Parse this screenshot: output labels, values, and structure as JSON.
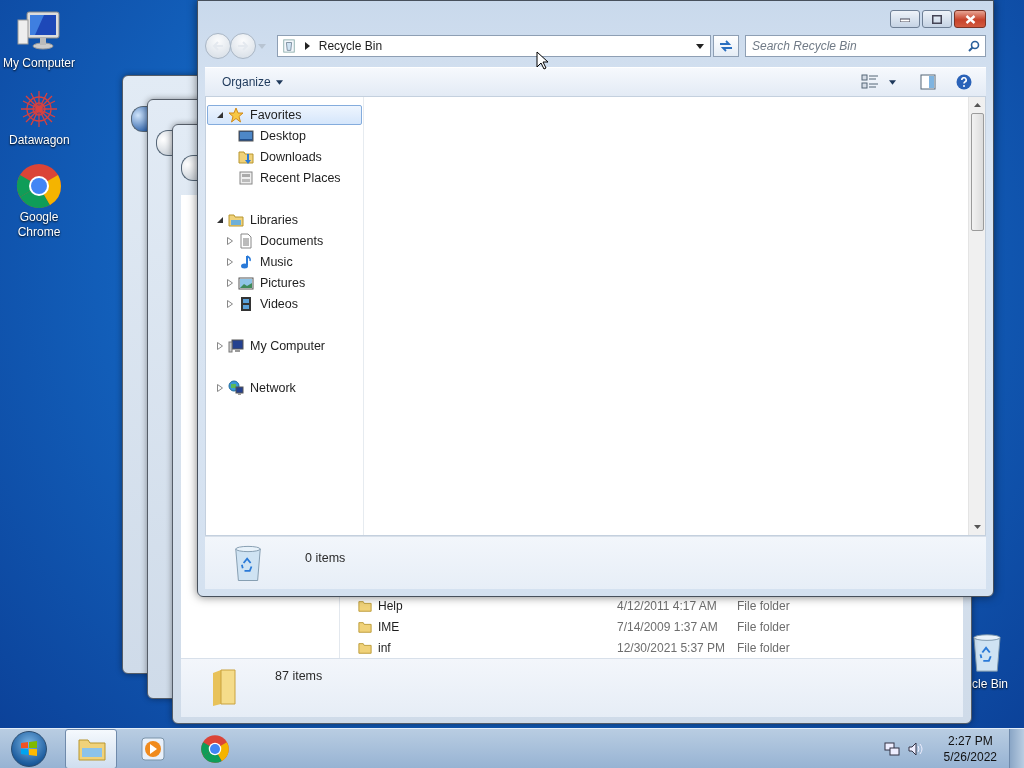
{
  "desktop_icons": [
    {
      "label": "My Computer",
      "kind": "computer"
    },
    {
      "label": "Datawagon",
      "kind": "datawagon"
    },
    {
      "label": "Google Chrome",
      "kind": "chrome"
    },
    {
      "label": "cle Bin",
      "kind": "recycle"
    }
  ],
  "background_window": {
    "rows": [
      {
        "name": "Help",
        "date": "4/12/2011 4:17 AM",
        "type": "File folder"
      },
      {
        "name": "IME",
        "date": "7/14/2009 1:37 AM",
        "type": "File folder"
      },
      {
        "name": "inf",
        "date": "12/30/2021 5:37 PM",
        "type": "File folder"
      }
    ],
    "status": "87 items"
  },
  "explorer": {
    "history": [
      {
        "kind": "back",
        "disabled": true
      },
      {
        "kind": "forward",
        "disabled": true
      }
    ],
    "address": "Recycle Bin",
    "search": {
      "placeholder": "Search Recycle Bin"
    },
    "organize": "Organize",
    "nav": [
      {
        "label": "Favorites",
        "kind": "star",
        "expanded": true,
        "selected": true,
        "children": [
          {
            "label": "Desktop",
            "kind": "desktop",
            "selected": false
          },
          {
            "label": "Downloads",
            "kind": "downloads",
            "selected": false
          },
          {
            "label": "Recent Places",
            "kind": "recent",
            "selected": false
          }
        ]
      },
      {
        "label": "Libraries",
        "kind": "libraries",
        "expanded": true,
        "selected": false,
        "children": [
          {
            "label": "Documents",
            "kind": "documents",
            "expanded": false,
            "selected": false
          },
          {
            "label": "Music",
            "kind": "music",
            "expanded": false,
            "selected": false
          },
          {
            "label": "Pictures",
            "kind": "pictures",
            "expanded": false,
            "selected": false
          },
          {
            "label": "Videos",
            "kind": "videos",
            "expanded": false,
            "selected": false
          }
        ]
      },
      {
        "label": "My Computer",
        "kind": "computer",
        "expanded": false,
        "selected": false
      },
      {
        "label": "Network",
        "kind": "network",
        "expanded": false,
        "selected": false
      }
    ],
    "status": "0 items"
  },
  "taskbar": {
    "items": [
      {
        "kind": "explorer",
        "active": true
      },
      {
        "kind": "media",
        "active": false
      },
      {
        "kind": "chrome",
        "active": false
      }
    ],
    "time": "2:27 PM",
    "date": "5/26/2022"
  }
}
